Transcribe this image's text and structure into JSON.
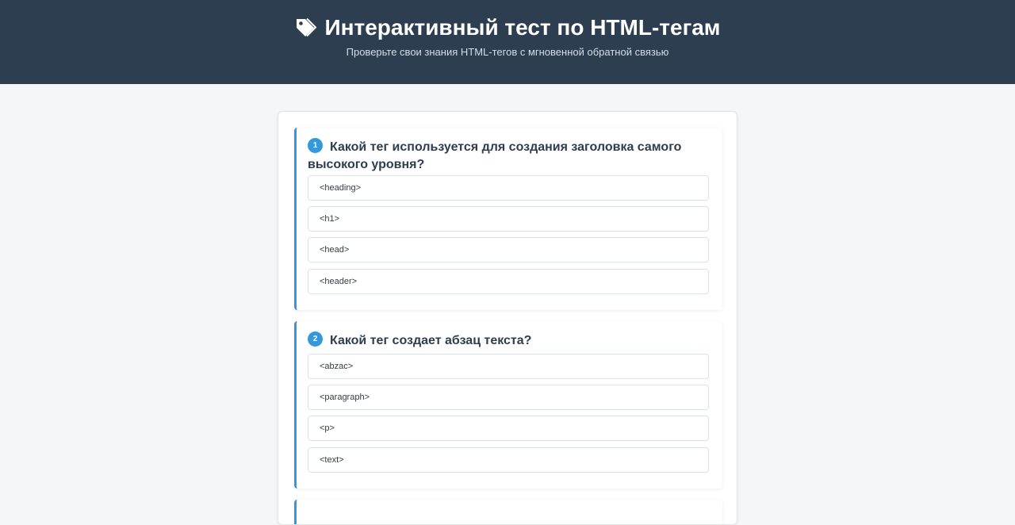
{
  "header": {
    "title": "Интерактивный тест по HTML-тегам",
    "subtitle": "Проверьте свои знания HTML-тегов с мгновенной обратной связью",
    "icon": "tag-icon"
  },
  "colors": {
    "header_bg": "#2c3e50",
    "accent": "#3498db",
    "page_bg": "#f4f6fa"
  },
  "questions": [
    {
      "number": "1",
      "text": "Какой тег используется для создания заголовка самого высокого уровня?",
      "options": [
        "<heading>",
        "<h1>",
        "<head>",
        "<header>"
      ]
    },
    {
      "number": "2",
      "text": "Какой тег создает абзац текста?",
      "options": [
        "<abzac>",
        "<paragraph>",
        "<p>",
        "<text>"
      ]
    }
  ]
}
